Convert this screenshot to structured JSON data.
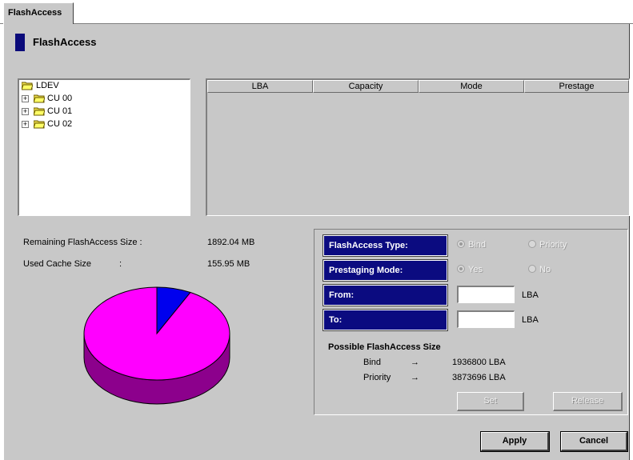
{
  "tab": {
    "label": "FlashAccess"
  },
  "header": {
    "title": "FlashAccess",
    "marker_color": "#0a0a7a"
  },
  "tree": {
    "root": "LDEV",
    "children": [
      {
        "label": "CU 00",
        "expander": "+"
      },
      {
        "label": "CU 01",
        "expander": "+"
      },
      {
        "label": "CU 02",
        "expander": "+"
      }
    ]
  },
  "table": {
    "columns": [
      "LBA",
      "Capacity",
      "Mode",
      "Prestage"
    ],
    "rows": []
  },
  "stats": {
    "remaining_label": "Remaining FlashAccess Size :",
    "remaining_value": "1892.04 MB",
    "used_label": "Used Cache Size",
    "used_colon": ":",
    "used_value": "155.95 MB"
  },
  "chart_data": {
    "type": "pie",
    "slices": [
      {
        "label": "Remaining FlashAccess Size",
        "value": 1892.04,
        "color": "#ff00ff"
      },
      {
        "label": "Used Cache Size",
        "value": 155.95,
        "color": "#0000ee"
      }
    ]
  },
  "form": {
    "type_label": "FlashAccess Type:",
    "type_options": [
      {
        "label": "Bind",
        "selected": true
      },
      {
        "label": "Priority",
        "selected": false
      }
    ],
    "mode_label": "Prestaging Mode:",
    "mode_options": [
      {
        "label": "Yes",
        "selected": true
      },
      {
        "label": "No",
        "selected": false
      }
    ],
    "from_label": "From:",
    "from_value": "",
    "to_label": "To:",
    "to_value": "",
    "unit": "LBA",
    "size_title": "Possible FlashAccess Size",
    "size_rows": [
      {
        "name": "Bind",
        "arrow": "→",
        "value": "1936800 LBA"
      },
      {
        "name": "Priority",
        "arrow": "→",
        "value": "3873696 LBA"
      }
    ],
    "set_label": "Set",
    "release_label": "Release"
  },
  "footer": {
    "apply_label": "Apply",
    "cancel_label": "Cancel"
  }
}
